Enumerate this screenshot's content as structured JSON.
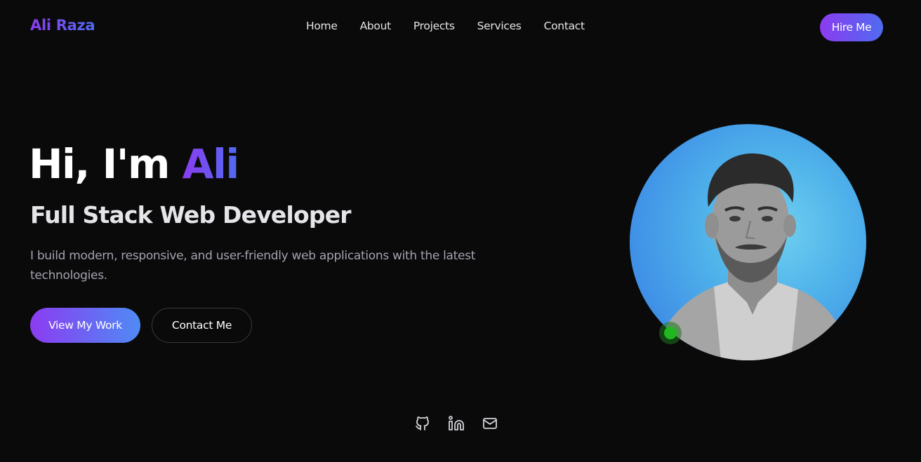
{
  "brand": {
    "name": "Ali Raza",
    "gradient": [
      "#8b3cf0",
      "#4f6bf0"
    ]
  },
  "nav": {
    "items": [
      {
        "label": "Home"
      },
      {
        "label": "About"
      },
      {
        "label": "Projects"
      },
      {
        "label": "Services"
      },
      {
        "label": "Contact"
      }
    ],
    "hire_label": "Hire Me"
  },
  "hero": {
    "greeting": "Hi, I'm ",
    "name": "Ali",
    "subtitle": "Full Stack Web Developer",
    "description": "I build modern, responsive, and user-friendly web applications with the latest technologies.",
    "primary_cta": "View My Work",
    "secondary_cta": "Contact Me"
  },
  "avatar": {
    "status": "online",
    "status_color": "#1fb81f"
  },
  "social": [
    {
      "icon": "github-icon"
    },
    {
      "icon": "linkedin-icon"
    },
    {
      "icon": "mail-icon"
    }
  ],
  "colors": {
    "background": "#0a0a0b",
    "accent_start": "#8b3cf0",
    "accent_end": "#4f6bf0"
  }
}
